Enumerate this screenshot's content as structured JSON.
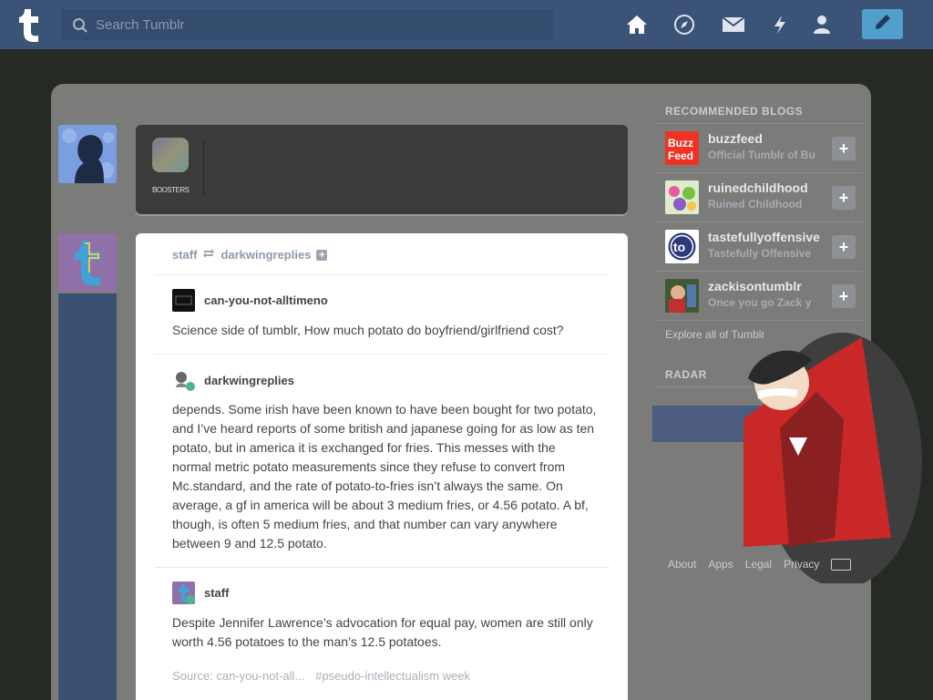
{
  "header": {
    "search_placeholder": "Search Tumblr",
    "nav": [
      "home-icon",
      "explore-icon",
      "inbox-icon",
      "activity-icon",
      "account-icon"
    ],
    "compose_icon": "pencil-icon"
  },
  "composer": {
    "caption": "BOOSTERS"
  },
  "post": {
    "header_user": "staff",
    "header_reblogged_from": "darkwingreplies",
    "entries": [
      {
        "author": "can-you-not-alltimeno",
        "text": "Science side of tumblr, How much potato do boyfriend/girlfriend cost?"
      },
      {
        "author": "darkwingreplies",
        "text": "depends. Some irish have been known to have been bought for two potato, and I’ve heard reports of some british and japanese going for as low as ten potato, but in america it is exchanged for fries. This messes with the normal metric potato measurements since they refuse to convert from Mc.standard, and the rate of potato-to-fries isn’t always the same. On average, a gf in america will be about 3 medium fries, or 4.56 potato. A bf, though, is often 5 medium fries, and that number can vary anywhere between 9 and 12.5 potato."
      },
      {
        "author": "staff",
        "text": "Despite Jennifer Lawrence’s advocation for equal pay, women are still only worth 4.56 potatoes to the man’s 12.5 potatoes."
      }
    ],
    "source": "Source: can-you-not-all...",
    "tag": "#pseudo-intellectualism week"
  },
  "sidebar": {
    "recommended_title": "RECOMMENDED BLOGS",
    "blogs": [
      {
        "name": "buzzfeed",
        "desc": "Official Tumblr of Bu"
      },
      {
        "name": "ruinedchildhood",
        "desc": "Ruined Childhood"
      },
      {
        "name": "tastefullyoffensive",
        "desc": "Tastefully Offensive"
      },
      {
        "name": "zackisontumblr",
        "desc": "Once you go Zack y"
      }
    ],
    "explore": "Explore all of Tumblr",
    "radar_title": "RADAR",
    "footer": [
      "About",
      "Apps",
      "Legal",
      "Privacy"
    ]
  },
  "colors": {
    "header_bg": "#3a5376",
    "compose_bg": "#529ecc",
    "overlay": "#7b7b79"
  }
}
